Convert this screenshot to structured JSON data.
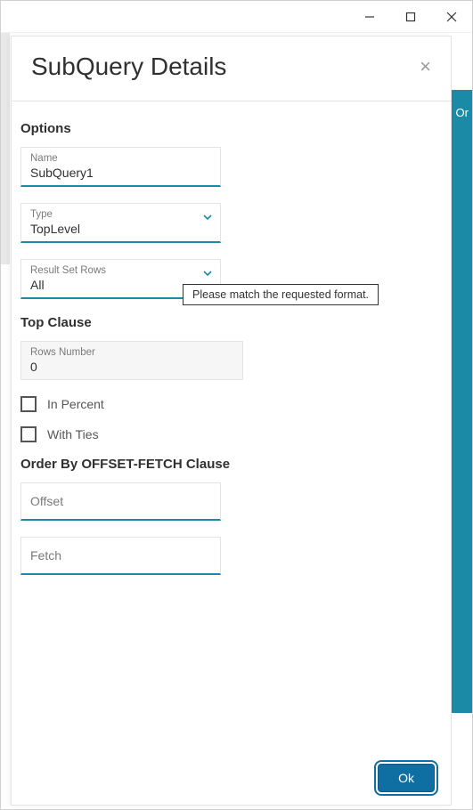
{
  "window": {
    "minimize_tip": "Minimize",
    "maximize_tip": "Maximize",
    "close_tip": "Close"
  },
  "background": {
    "side_label": "Or"
  },
  "modal": {
    "title": "SubQuery Details",
    "close_label": "×",
    "sections": {
      "options": {
        "title": "Options",
        "name": {
          "label": "Name",
          "value": "SubQuery1"
        },
        "type": {
          "label": "Type",
          "value": "TopLevel"
        },
        "result_set": {
          "label": "Result Set Rows",
          "value": "All"
        }
      },
      "top_clause": {
        "title": "Top Clause",
        "rows_number": {
          "label": "Rows Number",
          "value": "0"
        },
        "in_percent": {
          "label": "In Percent",
          "checked": false
        },
        "with_ties": {
          "label": "With Ties",
          "checked": false
        }
      },
      "order_by": {
        "title": "Order By OFFSET-FETCH Clause",
        "offset": {
          "placeholder": "Offset",
          "value": ""
        },
        "fetch": {
          "placeholder": "Fetch",
          "value": ""
        }
      }
    },
    "tooltip": "Please match the requested format.",
    "footer": {
      "ok": "Ok"
    }
  }
}
